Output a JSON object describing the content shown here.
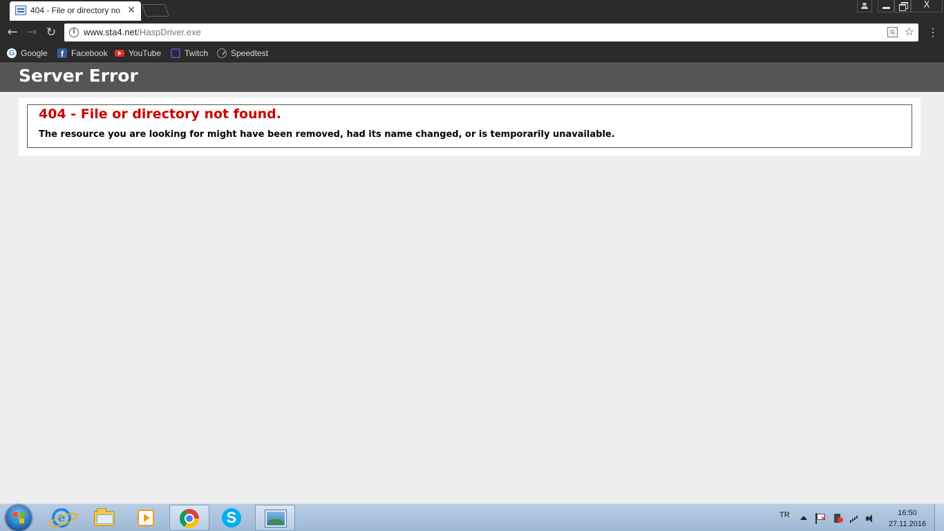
{
  "browser": {
    "tab": {
      "title": "404 - File or directory no",
      "close_label": "✕"
    },
    "window_controls": {
      "close_label": "X"
    },
    "address_bar": {
      "host": "www.sta4.net",
      "path": "/HaspDriver.exe"
    },
    "bookmarks": [
      {
        "label": "Google",
        "icon": "google-icon"
      },
      {
        "label": "Facebook",
        "icon": "facebook-icon"
      },
      {
        "label": "YouTube",
        "icon": "youtube-icon"
      },
      {
        "label": "Twitch",
        "icon": "twitch-icon"
      },
      {
        "label": "Speedtest",
        "icon": "speedtest-icon"
      }
    ]
  },
  "page": {
    "header_title": "Server Error",
    "error_heading": "404 - File or directory not found.",
    "error_message": "The resource you are looking for might have been removed, had its name changed, or is temporarily unavailable."
  },
  "taskbar": {
    "pinned": [
      {
        "icon": "internet-explorer-icon"
      },
      {
        "icon": "file-explorer-icon"
      },
      {
        "icon": "media-player-icon"
      },
      {
        "icon": "chrome-icon",
        "active": true
      },
      {
        "icon": "skype-icon"
      },
      {
        "icon": "photo-viewer-icon",
        "active": true
      }
    ],
    "language": "TR",
    "clock": {
      "time": "16:50",
      "date": "27.11.2016"
    }
  },
  "colors": {
    "header_bg": "#555555",
    "page_bg": "#eeeeee",
    "error_red": "#cc0000",
    "browser_chrome": "#2b2b2b"
  }
}
